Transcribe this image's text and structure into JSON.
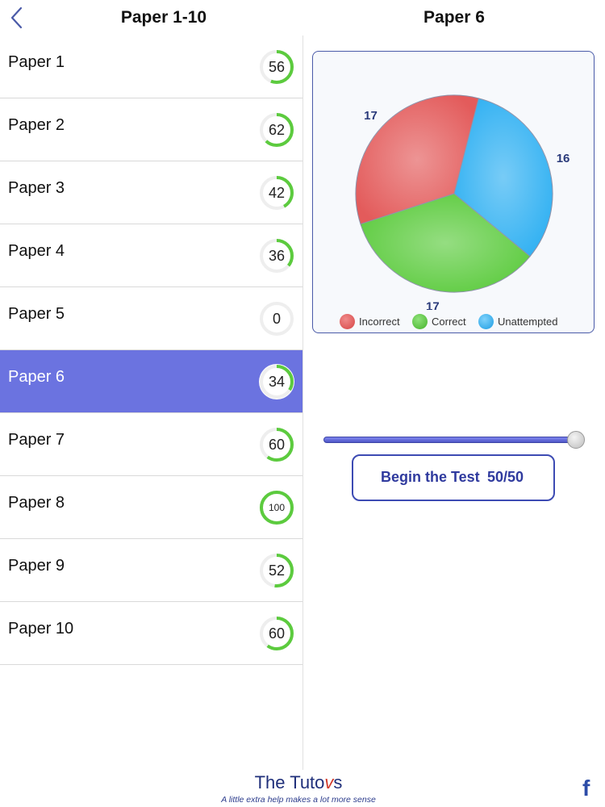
{
  "header": {
    "left_title": "Paper 1-10",
    "right_title": "Paper 6"
  },
  "papers": [
    {
      "label": "Paper 1",
      "score": "56",
      "progress": 0.56,
      "selected": false
    },
    {
      "label": "Paper 2",
      "score": "62",
      "progress": 0.62,
      "selected": false
    },
    {
      "label": "Paper 3",
      "score": "42",
      "progress": 0.42,
      "selected": false
    },
    {
      "label": "Paper 4",
      "score": "36",
      "progress": 0.36,
      "selected": false
    },
    {
      "label": "Paper 5",
      "score": "0",
      "progress": 0,
      "selected": false
    },
    {
      "label": "Paper 6",
      "score": "34",
      "progress": 0.34,
      "selected": true
    },
    {
      "label": "Paper 7",
      "score": "60",
      "progress": 0.6,
      "selected": false
    },
    {
      "label": "Paper 8",
      "score": "100",
      "progress": 1.0,
      "selected": false
    },
    {
      "label": "Paper 9",
      "score": "52",
      "progress": 0.52,
      "selected": false
    },
    {
      "label": "Paper 10",
      "score": "60",
      "progress": 0.6,
      "selected": false
    }
  ],
  "chart_data": {
    "type": "pie",
    "slices": [
      {
        "name": "Incorrect",
        "value": 17,
        "color": "#e35b5b"
      },
      {
        "name": "Unattempted",
        "value": 16,
        "color": "#2fb0f2"
      },
      {
        "name": "Correct",
        "value": 17,
        "color": "#5ccb3e"
      }
    ],
    "legend_placement": "bottom"
  },
  "legend": {
    "incorrect": "Incorrect",
    "correct": "Correct",
    "unattempted": "Unattempted"
  },
  "slider": {
    "value": 50,
    "max": 50
  },
  "begin_button": {
    "label": "Begin the Test",
    "count": "50/50"
  },
  "footer": {
    "logo_prefix": "The Tuto",
    "logo_v": "v",
    "logo_suffix": "s",
    "tagline": "A little extra help makes a lot more sense",
    "facebook": "f"
  },
  "colors": {
    "accent": "#6b73e0",
    "ring_green": "#5ccb3e",
    "ring_track": "#eeeeee",
    "button_border": "#3d4bb3"
  }
}
